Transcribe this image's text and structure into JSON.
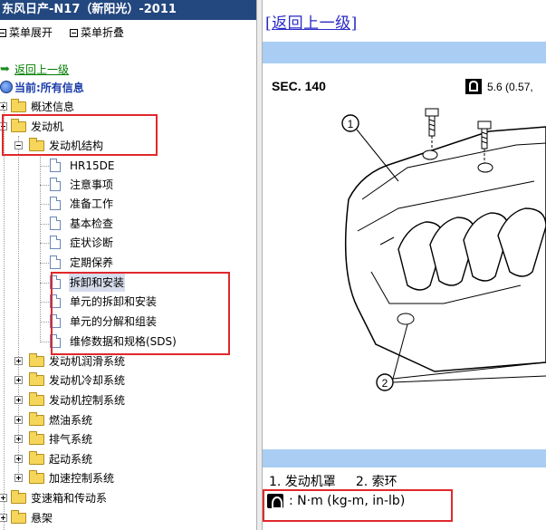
{
  "window_title": "东风日产-N17（新阳光）-2011",
  "menu": {
    "expand_label": "菜单展开",
    "collapse_label": "菜单折叠"
  },
  "nav": {
    "back_up_label": "返回上一级",
    "current_label": "当前:所有信息"
  },
  "tree": {
    "overview": "概述信息",
    "engine": "发动机",
    "engine_structure": "发动机结构",
    "engine_structure_items": [
      "HR15DE",
      "注意事项",
      "准备工作",
      "基本检查",
      "症状诊断",
      "定期保养",
      "拆卸和安装",
      "单元的拆卸和安装",
      "单元的分解和组装",
      "维修数据和规格(SDS)"
    ],
    "engine_systems": [
      "发动机润滑系统",
      "发动机冷却系统",
      "发动机控制系统",
      "燃油系统",
      "排气系统",
      "起动系统",
      "加速控制系统"
    ],
    "transmission": "变速箱和传动系",
    "suspension": "悬架"
  },
  "content": {
    "back_link": "[返回上一级]",
    "figure_section": "SEC. 140",
    "torque_value": "5.6 (0.57,",
    "callout_1": "1",
    "callout_2": "2",
    "caption_item_1": "1. 发动机罩",
    "caption_item_2": "2. 索环",
    "legend_units": ": N·m (kg-m, in-lb)"
  },
  "colors": {
    "title_bar": "#23477f",
    "highlight_box": "#e0282c",
    "content_band": "#a9cdf3",
    "link": "#2a2ac6",
    "back_up_link": "#007d00"
  }
}
